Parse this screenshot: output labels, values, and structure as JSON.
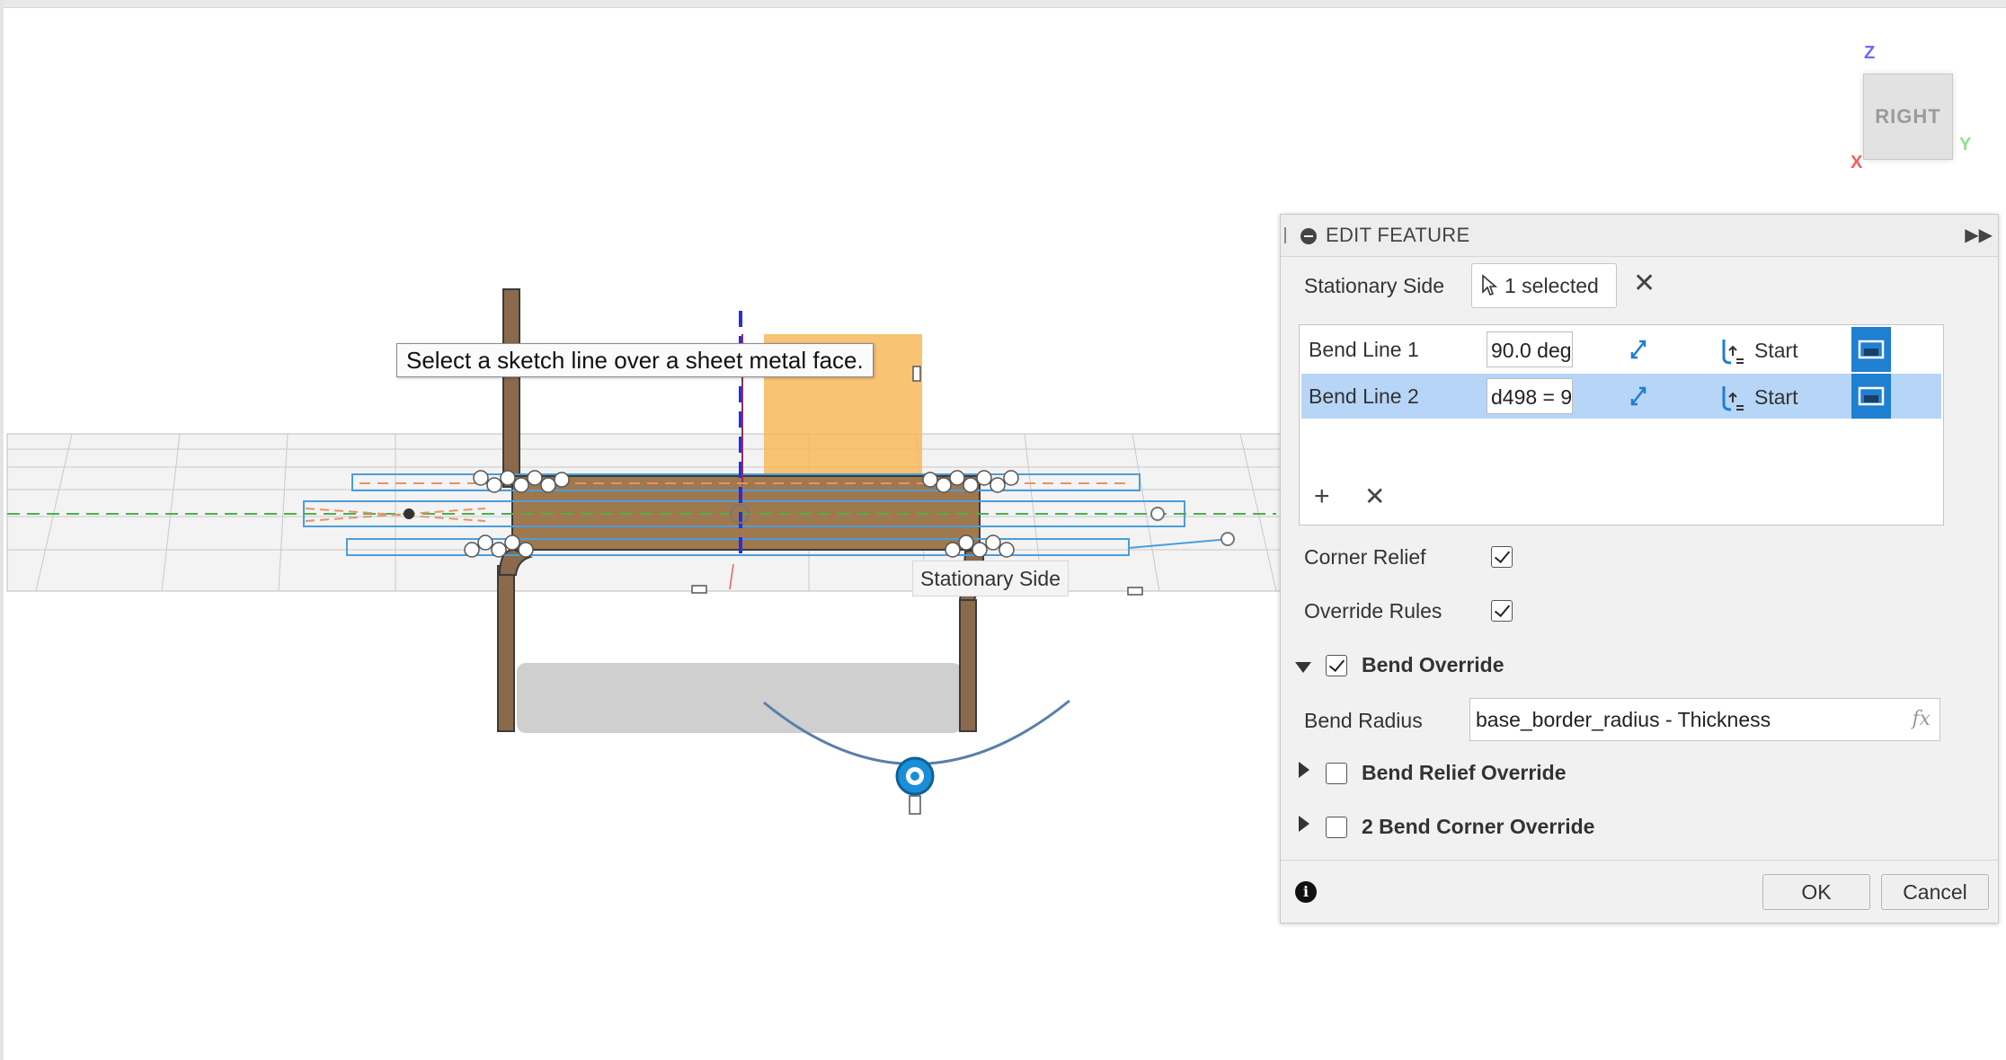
{
  "viewport": {
    "tooltip": "Select a sketch line over a sheet metal face.",
    "stationary_label": "Stationary Side"
  },
  "viewcube": {
    "face": "RIGHT",
    "axis_z": "Z",
    "axis_x": "X",
    "axis_y": "Y"
  },
  "panel": {
    "title": "EDIT FEATURE",
    "stationary_side_label": "Stationary Side",
    "selection_text": "1 selected",
    "bend_lines": [
      {
        "name": "Bend Line 1",
        "angle": "90.0 deg",
        "direction": "Start"
      },
      {
        "name": "Bend Line 2",
        "angle": "d498 = 9",
        "direction": "Start"
      }
    ],
    "corner_relief_label": "Corner Relief",
    "corner_relief_checked": true,
    "override_rules_label": "Override Rules",
    "override_rules_checked": true,
    "bend_override_label": "Bend Override",
    "bend_override_checked": true,
    "bend_radius_label": "Bend Radius",
    "bend_radius_value": "base_border_radius - Thickness",
    "fx_label": "fx",
    "bend_relief_override_label": "Bend Relief Override",
    "bend_relief_override_checked": false,
    "corner_override_label": "2 Bend Corner Override",
    "corner_override_checked": false,
    "ok_label": "OK",
    "cancel_label": "Cancel",
    "accent_color": "#1f7fd1",
    "selected_row_color": "#b7d5f7"
  }
}
